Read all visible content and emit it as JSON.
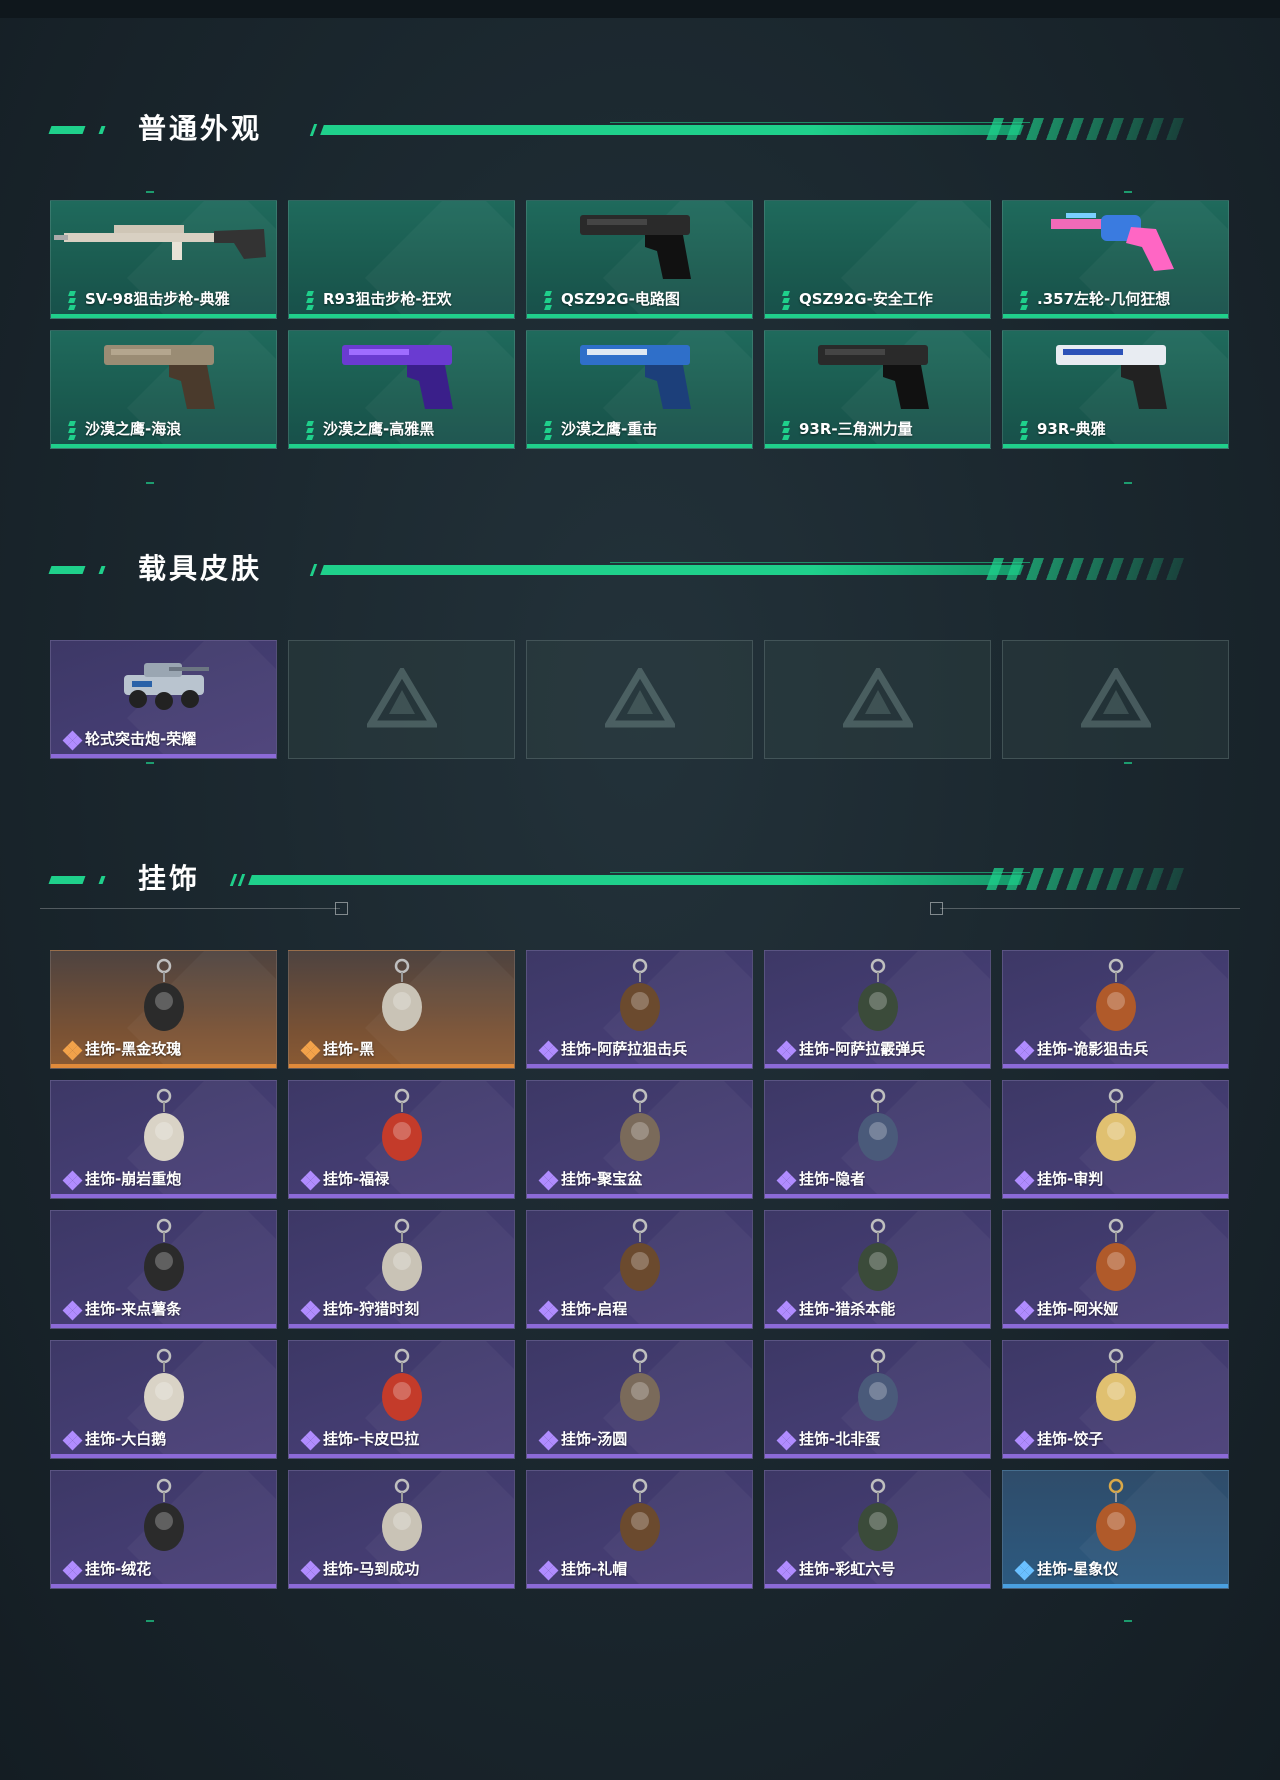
{
  "sections": {
    "weapons": {
      "title": "普通外观",
      "items": [
        {
          "label": "SV-98狙击步枪-典雅",
          "art": "sniper-rifle-icon"
        },
        {
          "label": "R93狙击步枪-狂欢",
          "art": ""
        },
        {
          "label": "QSZ92G-电路图",
          "art": "pistol-icon"
        },
        {
          "label": "QSZ92G-安全工作",
          "art": ""
        },
        {
          "label": ".357左轮-几何狂想",
          "art": "revolver-icon"
        },
        {
          "label": "沙漠之鹰-海浪",
          "art": "pistol-icon"
        },
        {
          "label": "沙漠之鹰-高雅黑",
          "art": "pistol-icon"
        },
        {
          "label": "沙漠之鹰-重击",
          "art": "pistol-icon"
        },
        {
          "label": "93R-三角洲力量",
          "art": "pistol-icon"
        },
        {
          "label": "93R-典雅",
          "art": "pistol-icon"
        }
      ]
    },
    "vehicles": {
      "title": "载具皮肤",
      "items": [
        {
          "label": "轮式突击炮-荣耀",
          "art": "armored-vehicle-icon"
        }
      ],
      "empty_slots": 4
    },
    "charms": {
      "title": "挂饰",
      "items": [
        {
          "label": "挂饰-黑金玫瑰",
          "rarity": "orange"
        },
        {
          "label": "挂饰-黑",
          "rarity": "orange"
        },
        {
          "label": "挂饰-阿萨拉狙击兵",
          "rarity": "purple"
        },
        {
          "label": "挂饰-阿萨拉霰弹兵",
          "rarity": "purple"
        },
        {
          "label": "挂饰-诡影狙击兵",
          "rarity": "purple"
        },
        {
          "label": "挂饰-崩岩重炮",
          "rarity": "purple"
        },
        {
          "label": "挂饰-福禄",
          "rarity": "purple"
        },
        {
          "label": "挂饰-聚宝盆",
          "rarity": "purple"
        },
        {
          "label": "挂饰-隐者",
          "rarity": "purple"
        },
        {
          "label": "挂饰-审判",
          "rarity": "purple"
        },
        {
          "label": "挂饰-来点薯条",
          "rarity": "purple"
        },
        {
          "label": "挂饰-狩猎时刻",
          "rarity": "purple"
        },
        {
          "label": "挂饰-启程",
          "rarity": "purple"
        },
        {
          "label": "挂饰-猎杀本能",
          "rarity": "purple"
        },
        {
          "label": "挂饰-阿米娅",
          "rarity": "purple"
        },
        {
          "label": "挂饰-大白鹅",
          "rarity": "purple"
        },
        {
          "label": "挂饰-卡皮巴拉",
          "rarity": "purple"
        },
        {
          "label": "挂饰-汤圆",
          "rarity": "purple"
        },
        {
          "label": "挂饰-北非蛋",
          "rarity": "purple"
        },
        {
          "label": "挂饰-饺子",
          "rarity": "purple"
        },
        {
          "label": "挂饰-绒花",
          "rarity": "purple"
        },
        {
          "label": "挂饰-马到成功",
          "rarity": "purple"
        },
        {
          "label": "挂饰-礼帽",
          "rarity": "purple"
        },
        {
          "label": "挂饰-彩虹六号",
          "rarity": "purple"
        },
        {
          "label": "挂饰-星象仪",
          "rarity": "blue"
        }
      ]
    }
  },
  "colors": {
    "accent": "#1fd08b",
    "purple_rarity": "#8c6ad8",
    "orange_rarity": "#e08a3a",
    "blue_rarity": "#4aa0e0"
  }
}
